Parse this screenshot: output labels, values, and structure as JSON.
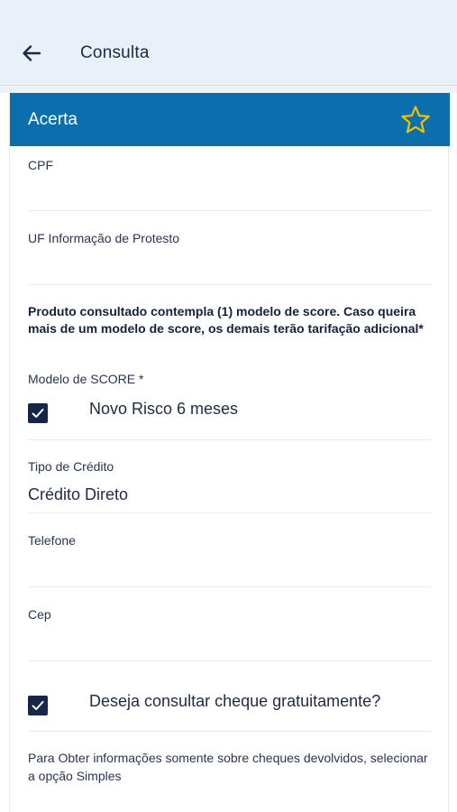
{
  "header": {
    "title": "Consulta",
    "back_icon": "arrow-left-icon",
    "background": "#e9f0f7"
  },
  "card": {
    "title": "Acerta",
    "header_color": "#0b6fae",
    "favorite_icon": "star-outline-icon",
    "favorite_color": "#f2c200"
  },
  "fields": {
    "cpf": {
      "label": "CPF",
      "value": ""
    },
    "uf_protesto": {
      "label": "UF Informação de Protesto",
      "value": ""
    },
    "notice": "Produto consultado contempla (1) modelo de score. Caso queira mais de um modelo de score, os demais terão tarifação adicional*",
    "score_model": {
      "label": "Modelo de SCORE *",
      "option_label": "Novo Risco 6 meses",
      "checked": true
    },
    "credit_type": {
      "label": "Tipo de Crédito",
      "value": "Crédito Direto"
    },
    "telefone": {
      "label": "Telefone",
      "value": ""
    },
    "cep": {
      "label": "Cep",
      "value": ""
    },
    "cheque": {
      "label": "Deseja consultar cheque gratuitamente?",
      "checked": true
    },
    "help_text": "Para Obter informações somente sobre cheques devolvidos, selecionar a opção Simples"
  },
  "colors": {
    "checkbox": "#16264a",
    "text": "#1f2a44"
  }
}
